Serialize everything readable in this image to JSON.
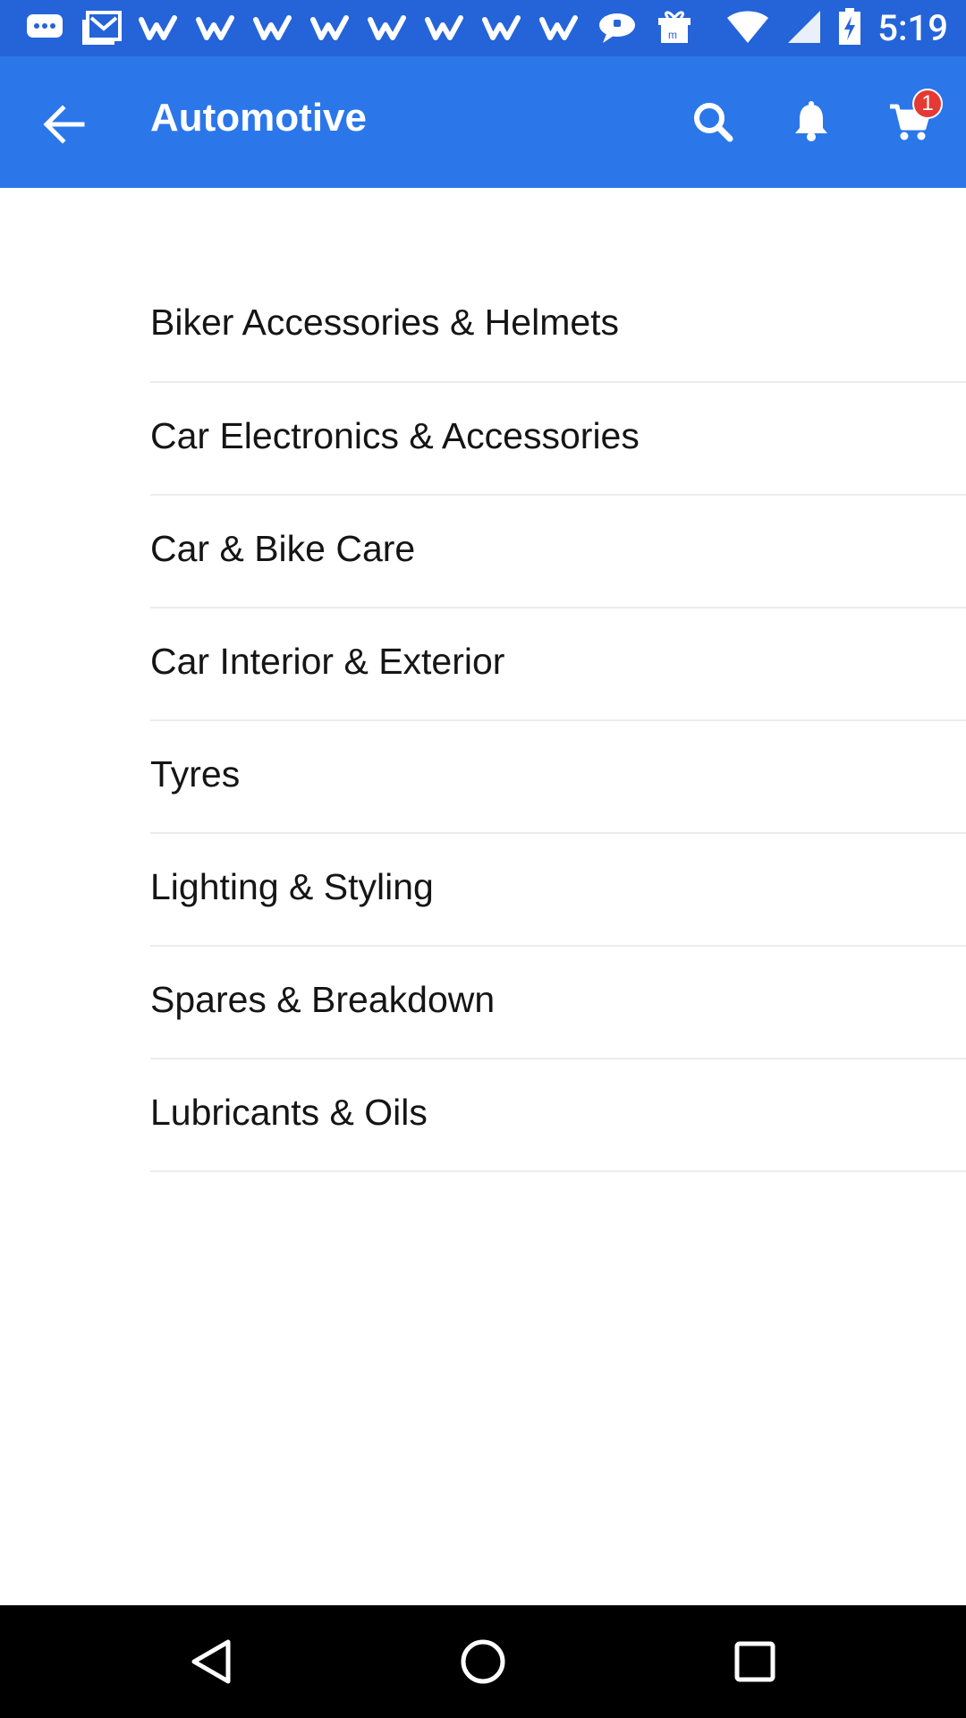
{
  "status_bar": {
    "time": "5:19",
    "left_icons": [
      "chat-bubble-icon",
      "gmail-icon",
      "wish-icon",
      "wish-icon",
      "wish-icon",
      "wish-icon",
      "wish-icon",
      "wish-icon",
      "wish-icon",
      "wish-icon",
      "message-icon",
      "gift-box-icon"
    ],
    "right_icons": [
      "wifi-icon",
      "signal-icon",
      "battery-charging-icon"
    ]
  },
  "app_bar": {
    "title": "Automotive",
    "cart_badge": "1",
    "colors": {
      "app_bar": "#2b77ea",
      "status_bar": "#2563d9",
      "badge": "#e53935"
    }
  },
  "categories": [
    {
      "label": "Biker Accessories & Helmets"
    },
    {
      "label": "Car Electronics & Accessories"
    },
    {
      "label": "Car & Bike Care"
    },
    {
      "label": "Car Interior & Exterior"
    },
    {
      "label": "Tyres"
    },
    {
      "label": "Lighting & Styling"
    },
    {
      "label": "Spares & Breakdown"
    },
    {
      "label": "Lubricants & Oils"
    }
  ]
}
